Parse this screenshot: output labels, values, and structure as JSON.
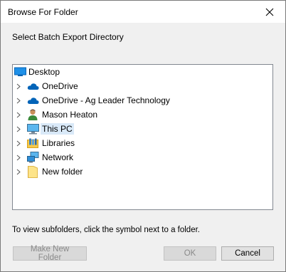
{
  "dialog": {
    "title": "Browse For Folder",
    "prompt": "Select Batch Export Directory",
    "hint": "To view subfolders, click the symbol next to a folder."
  },
  "tree": {
    "selected": "This PC",
    "items": [
      {
        "label": "Desktop",
        "icon": "desktop-icon",
        "expandable": false
      },
      {
        "label": "OneDrive",
        "icon": "cloud-icon",
        "expandable": true
      },
      {
        "label": "OneDrive - Ag Leader Technology",
        "icon": "cloud-icon",
        "expandable": true
      },
      {
        "label": "Mason Heaton",
        "icon": "user-icon",
        "expandable": true
      },
      {
        "label": "This PC",
        "icon": "computer-icon",
        "expandable": true
      },
      {
        "label": "Libraries",
        "icon": "libraries-icon",
        "expandable": true
      },
      {
        "label": "Network",
        "icon": "network-icon",
        "expandable": true
      },
      {
        "label": "New folder",
        "icon": "folder-icon",
        "expandable": true
      }
    ]
  },
  "buttons": {
    "make_new_folder": "Make New Folder",
    "ok": "OK",
    "cancel": "Cancel"
  },
  "colors": {
    "selection": "#d9e9f8",
    "accent": "#0078d7"
  }
}
